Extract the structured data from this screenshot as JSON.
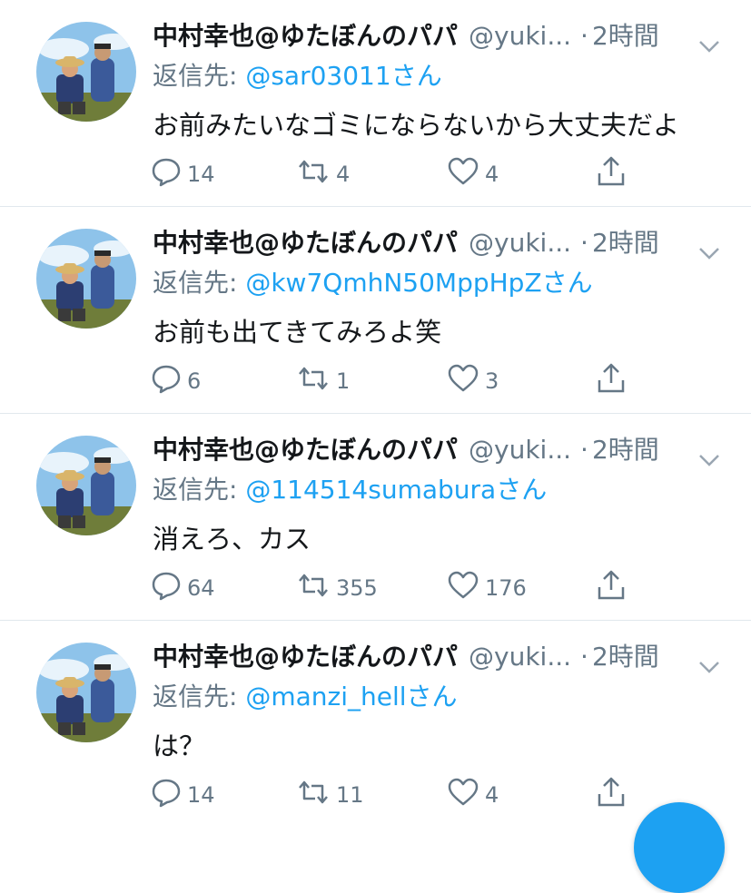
{
  "colors": {
    "accent": "#1da1f2",
    "muted": "#657786",
    "text": "#14171a",
    "divider": "#e1e8ed"
  },
  "tweets": [
    {
      "name": "中村幸也@ゆたぼんのパパ",
      "handle": "@yuki...",
      "dot": "·",
      "time": "2時間",
      "reply_label": "返信先: ",
      "reply_to": "@sar03011",
      "reply_suffix": "さん",
      "text": "お前みたいなゴミにならないから大丈夫だよ",
      "replies": "14",
      "retweets": "4",
      "likes": "4"
    },
    {
      "name": "中村幸也@ゆたぼんのパパ",
      "handle": "@yuki...",
      "dot": "·",
      "time": "2時間",
      "reply_label": "返信先: ",
      "reply_to": "@kw7QmhN50MppHpZ",
      "reply_suffix": "さん",
      "text": "お前も出てきてみろよ笑",
      "replies": "6",
      "retweets": "1",
      "likes": "3"
    },
    {
      "name": "中村幸也@ゆたぼんのパパ",
      "handle": "@yuki...",
      "dot": "·",
      "time": "2時間",
      "reply_label": "返信先: ",
      "reply_to": "@114514sumabura",
      "reply_suffix": "さん",
      "text": "消えろ、カス",
      "replies": "64",
      "retweets": "355",
      "likes": "176"
    },
    {
      "name": "中村幸也@ゆたぼんのパパ",
      "handle": "@yuki...",
      "dot": "·",
      "time": "2時間",
      "reply_label": "返信先: ",
      "reply_to": "@manzi_hell",
      "reply_suffix": "さん",
      "text": "は？",
      "replies": "14",
      "retweets": "11",
      "likes": "4"
    }
  ]
}
